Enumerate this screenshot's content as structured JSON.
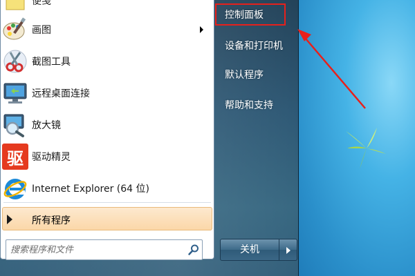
{
  "programs": [
    {
      "label": "便笺",
      "icon": "notes-icon",
      "has_submenu": false
    },
    {
      "label": "画图",
      "icon": "paint-icon",
      "has_submenu": true
    },
    {
      "label": "截图工具",
      "icon": "snipping-tool-icon",
      "has_submenu": false
    },
    {
      "label": "远程桌面连接",
      "icon": "remote-desktop-icon",
      "has_submenu": false
    },
    {
      "label": "放大镜",
      "icon": "magnifier-icon",
      "has_submenu": false
    },
    {
      "label": "驱动精灵",
      "icon": "driver-genius-icon",
      "icon_text": "驱",
      "has_submenu": false
    },
    {
      "label": "Internet Explorer (64 位)",
      "icon": "internet-explorer-icon",
      "has_submenu": false
    }
  ],
  "all_programs": {
    "label": "所有程序"
  },
  "search": {
    "placeholder": "搜索程序和文件"
  },
  "right_pane": {
    "items": [
      {
        "label": "控制面板",
        "highlighted": true
      },
      {
        "label": "设备和打印机"
      },
      {
        "label": "默认程序"
      },
      {
        "label": "帮助和支持"
      }
    ]
  },
  "shutdown": {
    "label": "关机"
  },
  "colors": {
    "highlight_box": "#e8201b",
    "annotation_arrow": "#e8201b",
    "menu_right_bg": "#2a5572",
    "all_programs_bg": "#fbd7a8"
  }
}
